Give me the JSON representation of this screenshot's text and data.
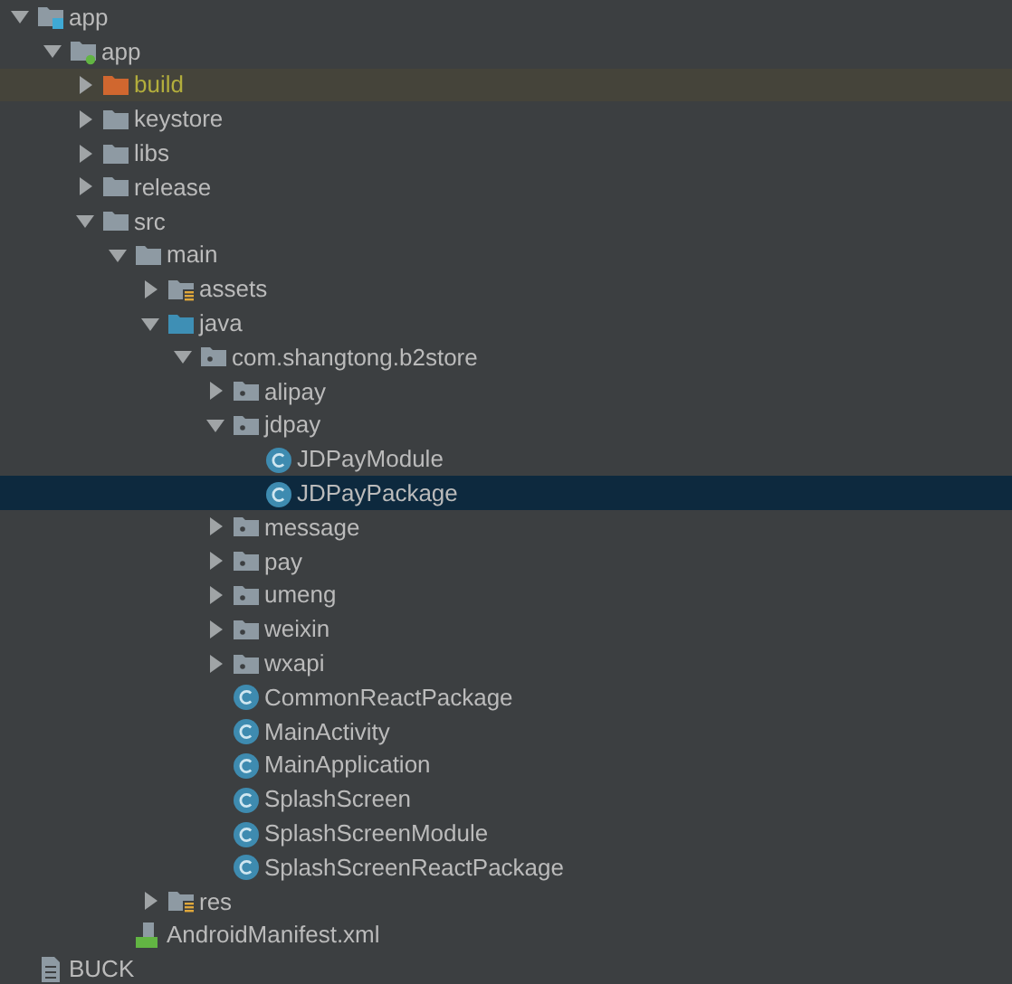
{
  "tree": [
    {
      "label": "app",
      "kind": "module-root",
      "expanded": true,
      "selected": false,
      "children": [
        {
          "label": "app",
          "kind": "module",
          "expanded": true,
          "selected": false,
          "children": [
            {
              "label": "build",
              "kind": "excluded-folder",
              "expanded": false,
              "selected": false
            },
            {
              "label": "keystore",
              "kind": "folder",
              "expanded": false,
              "selected": false
            },
            {
              "label": "libs",
              "kind": "folder",
              "expanded": false,
              "selected": false
            },
            {
              "label": "release",
              "kind": "folder",
              "expanded": false,
              "selected": false
            },
            {
              "label": "src",
              "kind": "folder",
              "expanded": true,
              "selected": false,
              "children": [
                {
                  "label": "main",
                  "kind": "folder",
                  "expanded": true,
                  "selected": false,
                  "children": [
                    {
                      "label": "assets",
                      "kind": "resource-folder",
                      "expanded": false,
                      "selected": false
                    },
                    {
                      "label": "java",
                      "kind": "source-folder",
                      "expanded": true,
                      "selected": false,
                      "children": [
                        {
                          "label": "com.shangtong.b2store",
                          "kind": "package",
                          "expanded": true,
                          "selected": false,
                          "children": [
                            {
                              "label": "alipay",
                              "kind": "package",
                              "expanded": false,
                              "selected": false
                            },
                            {
                              "label": "jdpay",
                              "kind": "package",
                              "expanded": true,
                              "selected": false,
                              "children": [
                                {
                                  "label": "JDPayModule",
                                  "kind": "class",
                                  "selected": false
                                },
                                {
                                  "label": "JDPayPackage",
                                  "kind": "class",
                                  "selected": true
                                }
                              ]
                            },
                            {
                              "label": "message",
                              "kind": "package",
                              "expanded": false,
                              "selected": false
                            },
                            {
                              "label": "pay",
                              "kind": "package",
                              "expanded": false,
                              "selected": false
                            },
                            {
                              "label": "umeng",
                              "kind": "package",
                              "expanded": false,
                              "selected": false
                            },
                            {
                              "label": "weixin",
                              "kind": "package",
                              "expanded": false,
                              "selected": false
                            },
                            {
                              "label": "wxapi",
                              "kind": "package",
                              "expanded": false,
                              "selected": false
                            },
                            {
                              "label": "CommonReactPackage",
                              "kind": "class",
                              "selected": false
                            },
                            {
                              "label": "MainActivity",
                              "kind": "class",
                              "selected": false
                            },
                            {
                              "label": "MainApplication",
                              "kind": "class",
                              "selected": false
                            },
                            {
                              "label": "SplashScreen",
                              "kind": "class",
                              "selected": false
                            },
                            {
                              "label": "SplashScreenModule",
                              "kind": "class",
                              "selected": false
                            },
                            {
                              "label": "SplashScreenReactPackage",
                              "kind": "class",
                              "selected": false
                            }
                          ]
                        }
                      ]
                    },
                    {
                      "label": "res",
                      "kind": "resource-folder",
                      "expanded": false,
                      "selected": false
                    }
                  ]
                },
                {
                  "label": "AndroidManifest.xml",
                  "kind": "manifest",
                  "selected": false
                }
              ]
            }
          ]
        }
      ]
    },
    {
      "label": "BUCK",
      "kind": "file",
      "selected": false
    }
  ]
}
